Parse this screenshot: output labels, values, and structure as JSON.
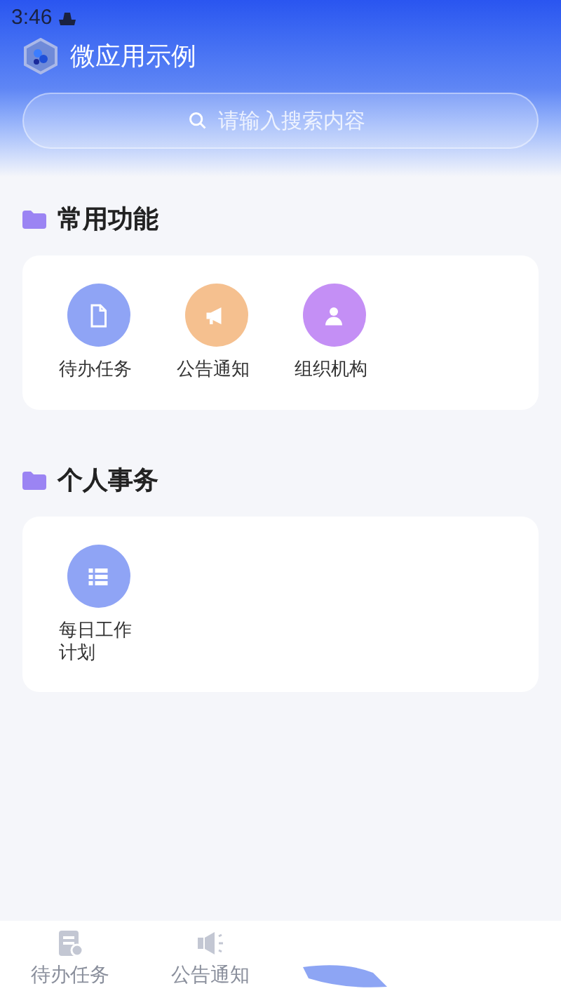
{
  "status_bar": {
    "time": "3:46"
  },
  "header": {
    "title": "微应用示例"
  },
  "search": {
    "placeholder": "请输入搜索内容"
  },
  "sections": [
    {
      "title": "常用功能",
      "items": [
        {
          "label": "待办任务",
          "kind": "document",
          "color": "#8fa4f5"
        },
        {
          "label": "公告通知",
          "kind": "megaphone",
          "color": "#f5c08f"
        },
        {
          "label": "组织机构",
          "kind": "person",
          "color": "#c48ff5"
        }
      ]
    },
    {
      "title": "个人事务",
      "items": [
        {
          "label": "每日工作计划",
          "kind": "list",
          "color": "#8fa4f5"
        }
      ]
    }
  ],
  "bottom_tabs": [
    {
      "label": "待办任务",
      "kind": "tasks",
      "selected": false
    },
    {
      "label": "公告通知",
      "kind": "notice",
      "selected": false
    }
  ]
}
